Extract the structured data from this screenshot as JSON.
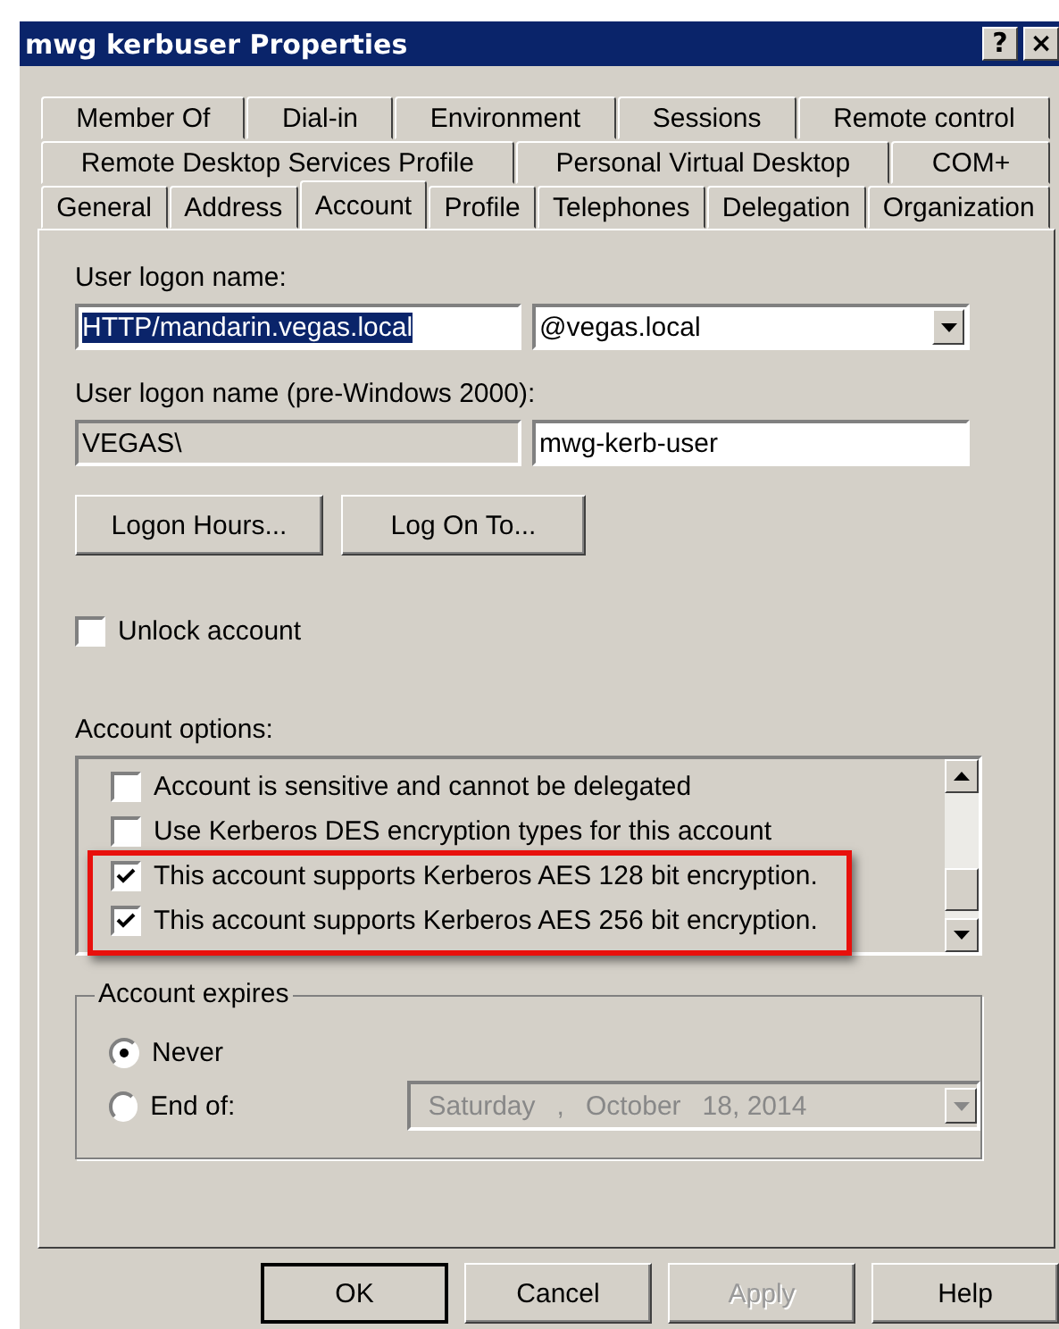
{
  "window": {
    "title": "mwg kerbuser Properties",
    "title_buttons": [
      "?",
      "×"
    ]
  },
  "tabs": [
    [
      {
        "label": "Member Of",
        "selected": false
      },
      {
        "label": "Dial-in",
        "selected": false
      },
      {
        "label": "Environment",
        "selected": false
      },
      {
        "label": "Sessions",
        "selected": false
      },
      {
        "label": "Remote control",
        "selected": false
      }
    ],
    [
      {
        "label": "Remote Desktop Services Profile",
        "selected": false
      },
      {
        "label": "Personal Virtual Desktop",
        "selected": false
      },
      {
        "label": "COM+",
        "selected": false
      }
    ],
    [
      {
        "label": "General",
        "selected": false
      },
      {
        "label": "Address",
        "selected": false
      },
      {
        "label": "Account",
        "selected": true
      },
      {
        "label": "Profile",
        "selected": false
      },
      {
        "label": "Telephones",
        "selected": false
      },
      {
        "label": "Delegation",
        "selected": false
      },
      {
        "label": "Organization",
        "selected": false
      }
    ]
  ],
  "logon_name": {
    "label": "User logon name:",
    "value": "HTTP/mandarin.vegas.local",
    "value_selected": true,
    "domain": "@vegas.local"
  },
  "pre2000": {
    "label": "User logon name (pre-Windows 2000):",
    "domain": "VEGAS\\",
    "value": "mwg-kerb-user"
  },
  "action_buttons": [
    "Logon Hours...",
    "Log On To..."
  ],
  "unlock": {
    "label": "Unlock account",
    "checked": false
  },
  "account_options": {
    "label": "Account options:",
    "items": [
      {
        "label": "Account is sensitive and cannot be delegated",
        "checked": false,
        "highlighted": false
      },
      {
        "label": "Use Kerberos DES encryption types for this account",
        "checked": false,
        "highlighted": false
      },
      {
        "label": "This account supports Kerberos AES 128 bit encryption.",
        "checked": true,
        "highlighted": true
      },
      {
        "label": "This account supports Kerberos AES 256 bit encryption.",
        "checked": true,
        "highlighted": true
      }
    ]
  },
  "account_expires": {
    "label": "Account expires",
    "options": [
      {
        "label": "Never",
        "selected": true
      },
      {
        "label": "End of:",
        "selected": false
      }
    ],
    "date": {
      "weekday": "Saturday",
      "sep": ",",
      "month": "October",
      "day_year": "18, 2014",
      "disabled": true
    }
  },
  "buttons": [
    {
      "label": "OK",
      "default": true,
      "disabled": false
    },
    {
      "label": "Cancel",
      "default": false,
      "disabled": false
    },
    {
      "label": "Apply",
      "default": false,
      "disabled": true
    },
    {
      "label": "Help",
      "default": false,
      "disabled": false
    }
  ]
}
